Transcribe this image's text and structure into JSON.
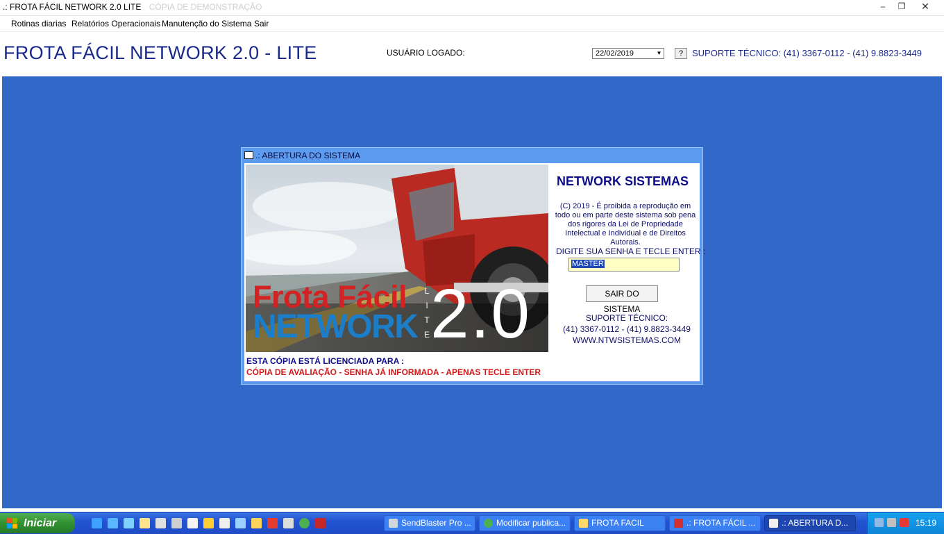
{
  "window": {
    "title": ".: FROTA FÁCIL NETWORK 2.0 LITE",
    "watermark": "CÓPIA DE DEMONSTRAÇÃO",
    "minimize": "–",
    "restore": "❐",
    "close": "✕"
  },
  "menu": {
    "items": [
      "Rotinas diarias",
      "Relatórios Operacionais",
      "Manutenção do Sistema",
      "Sair"
    ]
  },
  "header": {
    "app_title": "FROTA FÁCIL NETWORK 2.0  - LITE",
    "user_label": "USUÁRIO LOGADO:",
    "date": "22/02/2019",
    "help_label": "?",
    "support": "SUPORTE TÉCNICO: (41) 3367-0112 - (41) 9.8823-3449"
  },
  "dialog": {
    "title": ".: ABERTURA DO SISTEMA",
    "splash": {
      "word1": "Frota  Fácil",
      "word2": "NETWORK",
      "lite_letters": [
        "L",
        "I",
        "T",
        "E"
      ],
      "version": "2.0"
    },
    "company": "NETWORK SISTEMAS",
    "copyright": "(C) 2019 - É proibida a reprodução em todo ou em parte deste sistema  sob pena dos rigores da Lei de Propriedade Intelectual e Individual e de Direitos Autorais.",
    "password_label": "DIGITE SUA SENHA  E TECLE ENTER :",
    "password_value": "MASTER",
    "exit_button": "SAIR DO SISTEMA",
    "support_label": "SUPORTE TÉCNICO:",
    "support_phones": "(41) 3367-0112 - (41) 9.8823-3449",
    "website": "WWW.NTWSISTEMAS.COM",
    "license_label": "ESTA CÓPIA ESTÁ LICENCIADA PARA :",
    "license_value": "CÓPIA DE AVALIAÇÃO - SENHA JÁ INFORMADA - APENAS TECLE ENTER"
  },
  "taskbar": {
    "start_label": "Iniciar",
    "tasks": [
      {
        "label": "SendBlaster Pro ...",
        "icon": "sendblaster-icon"
      },
      {
        "label": "Modificar publica...",
        "icon": "chrome-icon"
      },
      {
        "label": "FROTA FACIL",
        "icon": "folder-icon"
      },
      {
        "label": ".: FROTA FÁCIL ...",
        "icon": "app-n-icon"
      },
      {
        "label": ".: ABERTURA D...",
        "icon": "app-window-icon"
      }
    ],
    "clock": "15:19"
  },
  "colors": {
    "desktop": "#3269c8",
    "title_blue": "#1a2a8c",
    "license_red": "#d31818",
    "network_blue": "#1c7ec8",
    "frota_red": "#d42222"
  }
}
